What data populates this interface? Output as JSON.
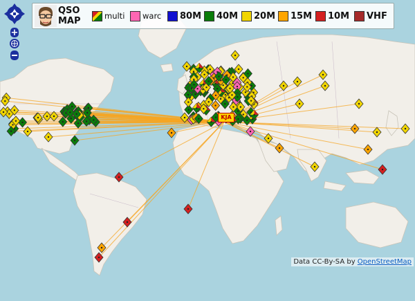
{
  "legend": {
    "title_line1": "QSO",
    "title_line2": "MAP",
    "items": [
      {
        "label": "multi",
        "color": "multi"
      },
      {
        "label": "warc",
        "color": "#ff66b3"
      },
      {
        "label": "80M",
        "color": "#1010d0"
      },
      {
        "label": "40M",
        "color": "#0a7d0a"
      },
      {
        "label": "20M",
        "color": "#f1d500"
      },
      {
        "label": "15M",
        "color": "#ffa500"
      },
      {
        "label": "10M",
        "color": "#d42020"
      },
      {
        "label": "VHF",
        "color": "#a52a2a"
      }
    ]
  },
  "zoom_controls": {
    "zoom_in": "+",
    "zoom_out": "−"
  },
  "home_label": "KJA",
  "attribution": {
    "prefix": "Data CC-By-SA by ",
    "link": "OpenStreetMap"
  },
  "map_style": {
    "sea": "#aad3df",
    "land": "#f2efe9",
    "lines": "#f5a623"
  }
}
